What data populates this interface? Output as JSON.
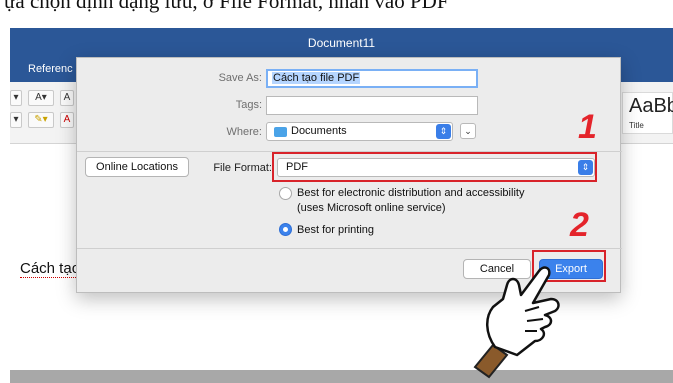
{
  "caption": {
    "text": "ựa chọn định dạng lưu, ở File Format, nhấn vào PDF"
  },
  "window": {
    "title": "Document11",
    "ribbon_tab": "Referenc",
    "style_preview": "AaBb(",
    "style_name": "Title",
    "ribbon_buttons": [
      "▾",
      "A",
      "▾"
    ]
  },
  "document": {
    "body_text": "Cách tạo"
  },
  "dialog": {
    "save_as_label": "Save As:",
    "save_as_value": "Cách tạo file PDF",
    "tags_label": "Tags:",
    "tags_value": "",
    "where_label": "Where:",
    "where_value": "Documents",
    "online_locations": "Online Locations",
    "file_format_label": "File Format:",
    "file_format_value": "PDF",
    "option1_line1": "Best for electronic distribution and accessibility",
    "option1_line2": "(uses Microsoft online service)",
    "option2": "Best for printing",
    "cancel": "Cancel",
    "export": "Export"
  },
  "annotations": {
    "step1": "1",
    "step2": "2"
  },
  "icons": {
    "folder": "folder-icon",
    "stepper": "up-down-arrows-icon",
    "expand": "chevron-down-icon",
    "hand": "pointing-hand-icon"
  },
  "colors": {
    "accent": "#3b82ec",
    "title_bar": "#2b5797",
    "highlight": "#d8232a"
  },
  "selected_option": "Best for printing"
}
